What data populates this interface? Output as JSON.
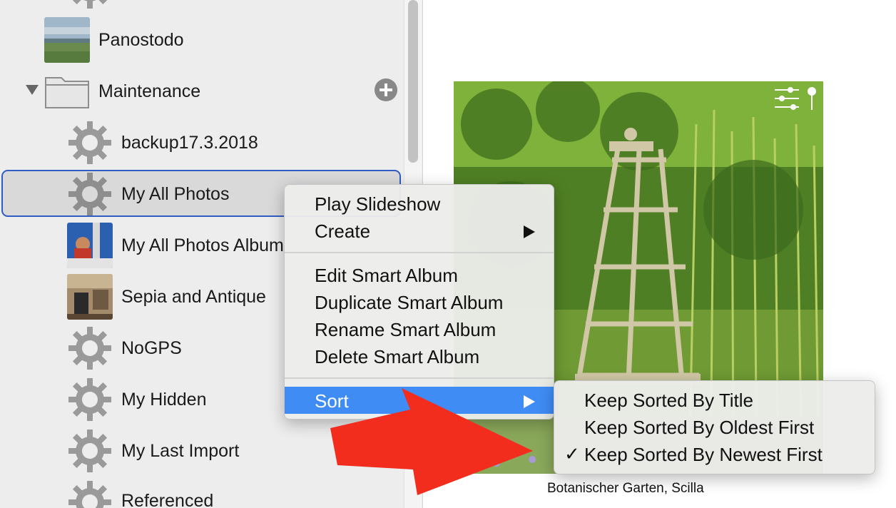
{
  "sidebar": {
    "items": [
      {
        "label": "Panostodo",
        "icon": "landscape-thumbnail"
      },
      {
        "label": "Maintenance",
        "icon": "folder-icon"
      },
      {
        "label": "backup17.3.2018",
        "icon": "gear-icon"
      },
      {
        "label": "My All Photos",
        "icon": "gear-icon"
      },
      {
        "label": "My All Photos Album",
        "icon": "album-thumbnail"
      },
      {
        "label": "Sepia and Antique",
        "icon": "album-thumbnail"
      },
      {
        "label": "NoGPS",
        "icon": "gear-icon"
      },
      {
        "label": "My Hidden",
        "icon": "gear-icon"
      },
      {
        "label": "My Last Import",
        "icon": "gear-icon"
      },
      {
        "label": "Referenced",
        "icon": "gear-icon"
      }
    ]
  },
  "context_menu": {
    "items": [
      {
        "label": "Play Slideshow"
      },
      {
        "label": "Create"
      },
      {
        "label": "Edit Smart Album"
      },
      {
        "label": "Duplicate Smart Album"
      },
      {
        "label": "Rename Smart Album"
      },
      {
        "label": "Delete Smart Album"
      },
      {
        "label": "Sort"
      }
    ],
    "highlighted": "Sort"
  },
  "sort_submenu": {
    "items": [
      {
        "label": "Keep Sorted By Title"
      },
      {
        "label": "Keep Sorted By Oldest First"
      },
      {
        "label": "Keep Sorted By Newest First"
      }
    ],
    "checked_mark": "✓",
    "checked": "Keep Sorted By Newest First"
  },
  "photo": {
    "caption": "Botanischer Garten, Scilla"
  },
  "colors": {
    "selection_border": "#2e5dc4",
    "menu_highlight": "#3f8cf5",
    "annotation_arrow": "#f22d1e"
  }
}
